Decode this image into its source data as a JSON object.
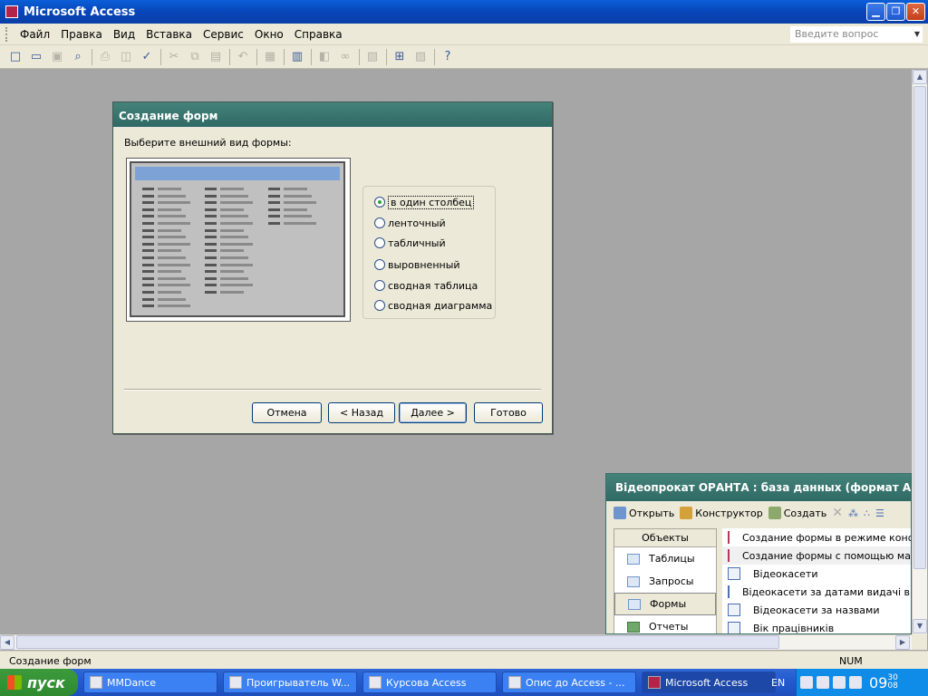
{
  "window": {
    "title": "Microsoft Access",
    "min_glyph": "▁",
    "max_glyph": "❐",
    "close_glyph": "✕"
  },
  "menu": {
    "items": [
      "Файл",
      "Правка",
      "Вид",
      "Вставка",
      "Сервис",
      "Окно",
      "Справка"
    ],
    "ask_placeholder": "Введите вопрос",
    "ask_dropdown": "▼"
  },
  "toolbar": {
    "icons": [
      "new-icon",
      "open-icon",
      "save-icon",
      "file-search-icon",
      "print-icon",
      "print-preview-icon",
      "spelling-icon",
      "cut-icon",
      "copy-icon",
      "paste-icon",
      "undo-icon",
      "analyze-icon",
      "office-links-icon",
      "code-icon",
      "script-icon",
      "properties-icon",
      "relationships-icon",
      "new-object-icon",
      "help-icon"
    ]
  },
  "dialog": {
    "title": "Создание форм",
    "prompt": "Выберите внешний вид формы:",
    "options": [
      {
        "label": "в один столбец",
        "selected": true
      },
      {
        "label": "ленточный",
        "selected": false
      },
      {
        "label": "табличный",
        "selected": false
      },
      {
        "label": "выровненный",
        "selected": false
      },
      {
        "label": "сводная таблица",
        "selected": false
      },
      {
        "label": "сводная диаграмма",
        "selected": false
      }
    ],
    "buttons": {
      "cancel": "Отмена",
      "back": "< Назад",
      "next": "Далее >",
      "finish": "Готово"
    }
  },
  "db_window": {
    "title": "Відеопрокат ОРАНТА : база данных (формат Access",
    "toolbar": {
      "open": "Открыть",
      "design": "Конструктор",
      "create": "Создать"
    },
    "objects_header": "Объекты",
    "objects": [
      {
        "label": "Таблицы",
        "selected": false
      },
      {
        "label": "Запросы",
        "selected": false
      },
      {
        "label": "Формы",
        "selected": true
      },
      {
        "label": "Отчеты",
        "selected": false
      }
    ],
    "items": [
      {
        "label": "Создание формы в режиме констр",
        "type": "wizard"
      },
      {
        "label": "Создание формы с помощью масте",
        "type": "wizard",
        "highlight": true
      },
      {
        "label": "Відеокасети",
        "type": "form"
      },
      {
        "label": "Відеокасети за датами видачі в пр",
        "type": "form"
      },
      {
        "label": "Відеокасети за назвами",
        "type": "form"
      },
      {
        "label": "Вік працівників",
        "type": "form"
      }
    ]
  },
  "statusbar": {
    "text": "Создание форм",
    "num": "NUM"
  },
  "taskbar": {
    "start": "пуск",
    "tasks": [
      {
        "label": "MMDance",
        "active": false
      },
      {
        "label": "Проигрыватель W...",
        "active": false
      },
      {
        "label": "Курсова Access",
        "active": false
      },
      {
        "label": "Опис до Access - ...",
        "active": false
      },
      {
        "label": "Microsoft Access",
        "active": true
      }
    ],
    "lang": "EN",
    "clock_hour": "09",
    "clock_min_top": "30",
    "clock_min_bottom": "08"
  },
  "colors": {
    "titlebar": "#0a5fd8",
    "dialog_title": "#3b766f",
    "taskbar": "#245bd0"
  }
}
